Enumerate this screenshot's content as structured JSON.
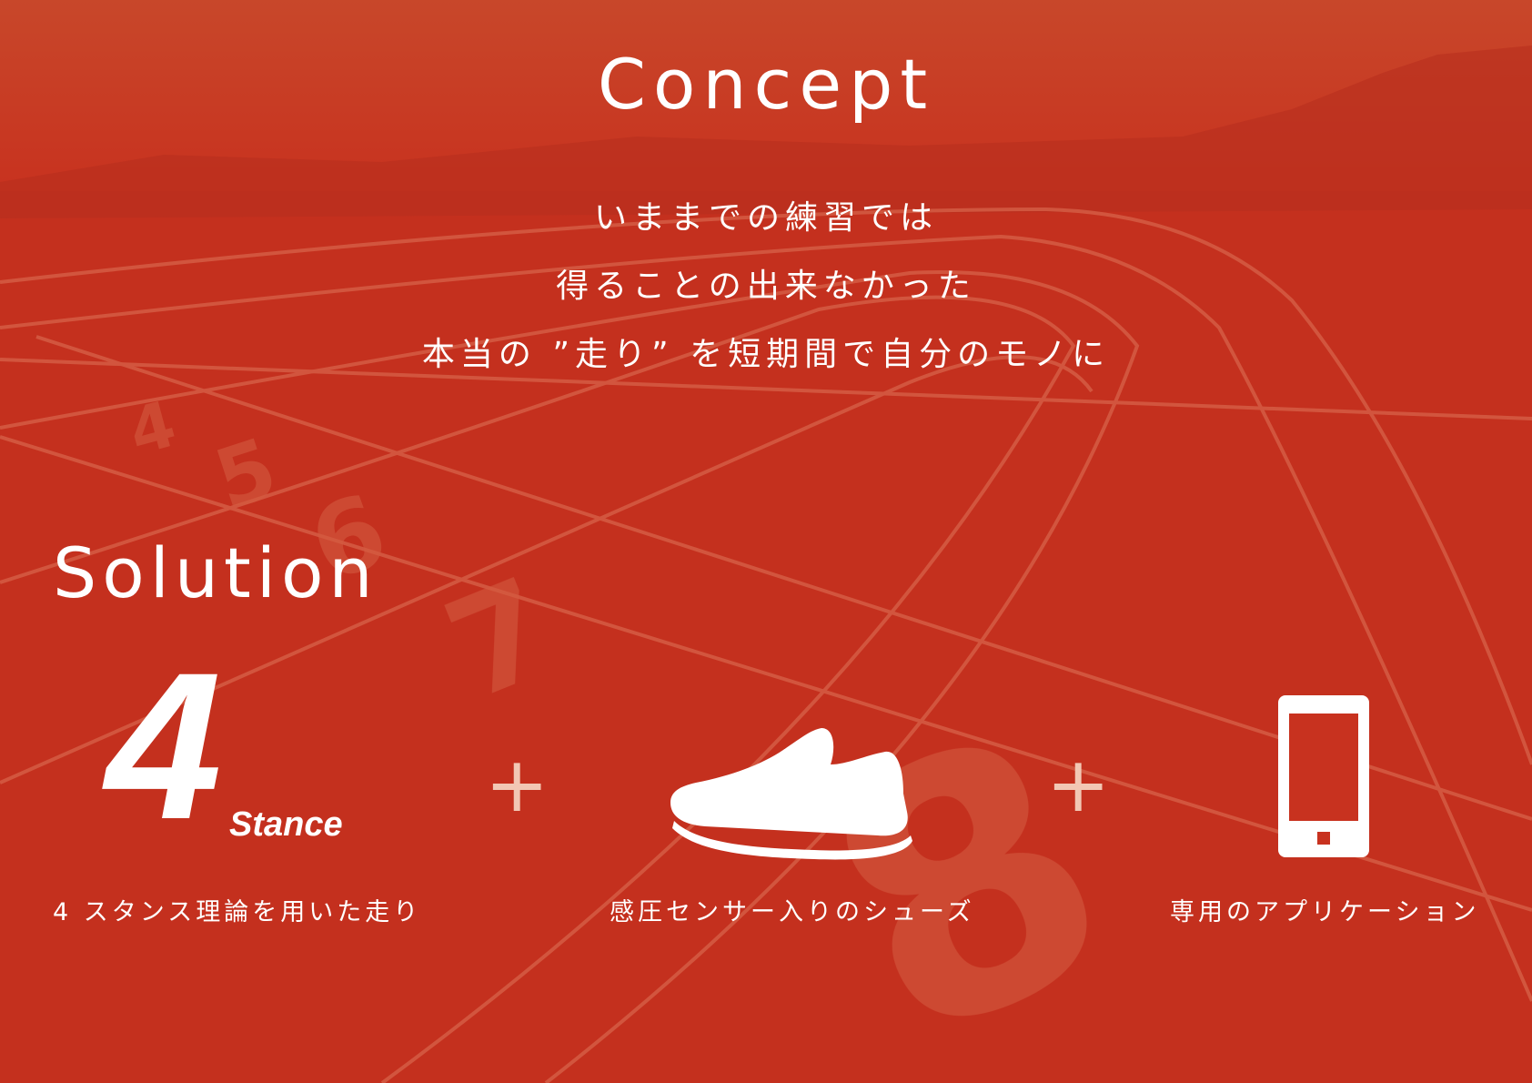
{
  "concept": {
    "title": "Concept",
    "lines": [
      "いままでの練習では",
      "得ることの出来なかった",
      "本当の ”走り” を短期間で自分のモノに"
    ]
  },
  "solution": {
    "title": "Solution",
    "logo": {
      "digit": "4",
      "word": "Stance"
    },
    "plus": "+",
    "items": [
      {
        "icon": "four-stance-logo",
        "caption": "4 スタンス理論を用いた走り"
      },
      {
        "icon": "shoe-icon",
        "caption": "感圧センサー入りのシューズ"
      },
      {
        "icon": "smartphone-icon",
        "caption": "専用のアプリケーション"
      }
    ]
  },
  "colors": {
    "background": "#c8321f",
    "text": "#ffffff",
    "accent": "#f2c7b4"
  }
}
